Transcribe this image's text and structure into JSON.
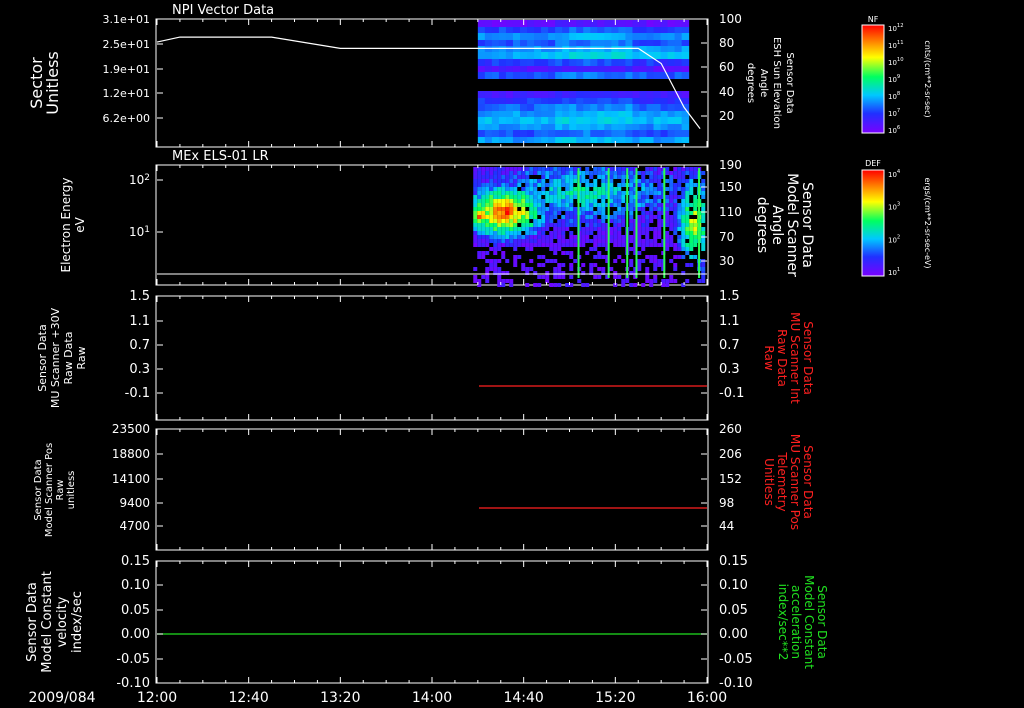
{
  "date_label": "2009/084",
  "time_ticks": [
    "12:00",
    "12:40",
    "13:20",
    "14:00",
    "14:40",
    "15:20",
    "16:00"
  ],
  "colors": {
    "background": "#000000",
    "foreground": "#ffffff",
    "red_trace": "#ff2020",
    "green_trace": "#20e020"
  },
  "panels": [
    {
      "id": "npi",
      "title": "NPI Vector Data",
      "left_label": [
        "Sector",
        "Unitless"
      ],
      "left_ticks": [
        "3.1e+01",
        "2.5e+01",
        "1.9e+01",
        "1.2e+01",
        "6.2e+00"
      ],
      "right_label": [
        "Sensor Data",
        "ESH Sun Elevation",
        "Angle",
        "degrees"
      ],
      "right_ticks": [
        "100",
        "80",
        "60",
        "40",
        "20"
      ],
      "colorbar": {
        "label": "NF",
        "unit": "cnts/(cm**2-sr-sec)",
        "ticks": [
          "10^12",
          "10^11",
          "10^10",
          "10^9",
          "10^8",
          "10^7",
          "10^6"
        ]
      }
    },
    {
      "id": "els",
      "title": "MEx ELS-01 LR",
      "left_label": [
        "Electron Energy",
        "eV"
      ],
      "left_ticks": [
        "10^2",
        "10^1"
      ],
      "right_label": [
        "Sensor Data",
        "Model Scanner",
        "Angle",
        "degrees"
      ],
      "right_ticks": [
        "190",
        "150",
        "110",
        "70",
        "30"
      ],
      "colorbar": {
        "label": "DEF",
        "unit": "ergs/(cm**2-sr-sec-eV)",
        "ticks": [
          "10^4",
          "10^3",
          "10^2",
          "10^1"
        ]
      }
    },
    {
      "id": "mu",
      "left_label": [
        "Sensor Data",
        "MU Scanner +30V",
        "Raw Data",
        "Raw"
      ],
      "left_ticks": [
        "1.5",
        "1.1",
        "0.7",
        "0.3",
        "-0.1"
      ],
      "right_label": [
        "Sensor Data",
        "MU Scanner Int",
        "Raw Data",
        "Raw"
      ],
      "right_ticks": [
        "1.5",
        "1.1",
        "0.7",
        "0.3",
        "-0.1"
      ]
    },
    {
      "id": "pos",
      "left_label": [
        "Sensor Data",
        "Model Scanner Pos",
        "Raw",
        "unitless"
      ],
      "left_ticks": [
        "23500",
        "18800",
        "14100",
        "9400",
        "4700"
      ],
      "right_label": [
        "Sensor Data",
        "MU Scanner Pos",
        "Telemetry",
        "Unitless"
      ],
      "right_ticks": [
        "260",
        "206",
        "152",
        "98",
        "44"
      ]
    },
    {
      "id": "vel",
      "left_label": [
        "Sensor Data",
        "Model Constant",
        "velocity",
        "index/sec"
      ],
      "left_ticks": [
        "0.15",
        "0.10",
        "0.05",
        "0.00",
        "-0.05",
        "-0.10"
      ],
      "right_label": [
        "Sensor Data",
        "Model Constant",
        "acceleration",
        "index/sec**2"
      ],
      "right_ticks": [
        "0.15",
        "0.10",
        "0.05",
        "0.00",
        "-0.05",
        "-0.10"
      ]
    }
  ],
  "chart_data": [
    {
      "type": "heatmap",
      "title": "NPI Vector Data",
      "ylabel": "Sector Unitless",
      "y2label": "Sensor Data ESH Sun Elevation Angle degrees",
      "ylim": [
        0,
        31
      ],
      "y2lim": [
        0,
        100
      ],
      "time_range": [
        "12:00",
        "16:00"
      ],
      "heatmap_time_range": [
        "14:20",
        "15:52"
      ],
      "overlay_line": {
        "name": "ESH Sun Elevation Angle",
        "t": [
          "12:00",
          "12:10",
          "12:50",
          "13:10",
          "13:20",
          "15:30",
          "15:40",
          "15:50",
          "15:57"
        ],
        "y": [
          82,
          86,
          86,
          80,
          77,
          77,
          65,
          30,
          13
        ]
      }
    },
    {
      "type": "heatmap",
      "title": "MEx ELS-01 LR",
      "ylabel": "Electron Energy eV",
      "y2label": "Sensor Data Model Scanner Angle degrees",
      "yscale": "log",
      "y2lim": [
        10,
        190
      ],
      "time_range": [
        "12:00",
        "16:00"
      ],
      "heatmap_time_range": [
        "14:18",
        "16:00"
      ],
      "overlay_line": {
        "name": "Model Scanner Angle",
        "t": [
          "12:00",
          "16:00"
        ],
        "y": [
          10,
          10
        ]
      }
    },
    {
      "type": "line",
      "ylabel": "Sensor Data MU Scanner +30V Raw Data Raw",
      "y2label": "Sensor Data MU Scanner Int Raw Data Raw",
      "ylim": [
        -0.3,
        1.5
      ],
      "series": [
        {
          "name": "MU Scanner Int",
          "color": "#ff2020",
          "t": [
            "14:18",
            "15:58"
          ],
          "y": [
            0.0,
            0.0
          ]
        }
      ]
    },
    {
      "type": "line",
      "ylabel": "Sensor Data Model Scanner Pos Raw unitless",
      "y2label": "Sensor Data MU Scanner Pos Telemetry Unitless",
      "ylim": [
        0,
        23500
      ],
      "y2lim": [
        0,
        260
      ],
      "series": [
        {
          "name": "MU Scanner Pos",
          "color": "#ff2020",
          "axis": "right",
          "t": [
            "14:18",
            "15:58"
          ],
          "y": [
            85,
            85
          ]
        }
      ]
    },
    {
      "type": "line",
      "ylabel": "Sensor Data Model Constant velocity index/sec",
      "y2label": "Sensor Data Model Constant acceleration index/sec**2",
      "ylim": [
        -0.1,
        0.15
      ],
      "series": [
        {
          "name": "Model Constant velocity",
          "color": "#20e020",
          "t": [
            "12:00",
            "15:58"
          ],
          "y": [
            0.0,
            0.0
          ]
        }
      ]
    }
  ]
}
